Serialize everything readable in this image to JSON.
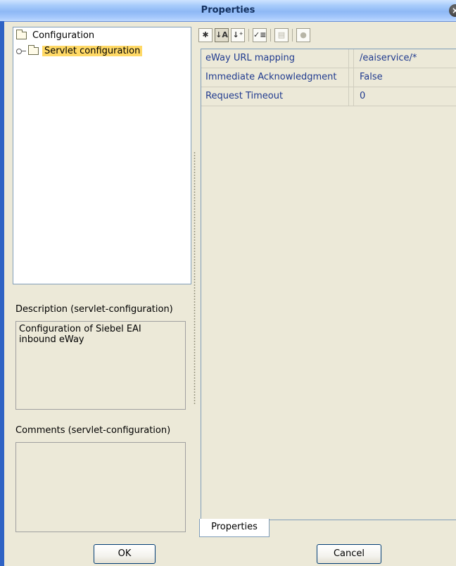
{
  "window": {
    "title": "Properties",
    "close_icon": "close-icon"
  },
  "tree": {
    "root": {
      "label": "Configuration",
      "icon": "folder-icon"
    },
    "child": {
      "label": "Servlet configuration",
      "icon": "folder-icon",
      "expander_icon": "expand-icon"
    }
  },
  "description": {
    "label": "Description (servlet-configuration)",
    "text_line1": "Configuration of Siebel EAI",
    "text_line2": "inbound eWay"
  },
  "comments": {
    "label": "Comments (servlet-configuration)",
    "text": ""
  },
  "toolbar": {
    "icons": [
      "categorized-icon",
      "sort-ascending-icon",
      "sort-descending-icon",
      "show-properties-icon",
      "description-icon",
      "help-icon"
    ]
  },
  "properties": {
    "rows": [
      {
        "name": "eWay URL mapping",
        "value": "/eaiservice/*"
      },
      {
        "name": "Immediate Acknowledgment",
        "value": "False"
      },
      {
        "name": "Request Timeout",
        "value": "0"
      }
    ]
  },
  "tabs": {
    "properties": "Properties"
  },
  "buttons": {
    "ok": "OK",
    "cancel": "Cancel"
  },
  "colors": {
    "titlebar": "#a9cdfb",
    "selected_bg": "#ffd966",
    "property_text": "#1f3a8f",
    "window_bg": "#ece9d8"
  }
}
